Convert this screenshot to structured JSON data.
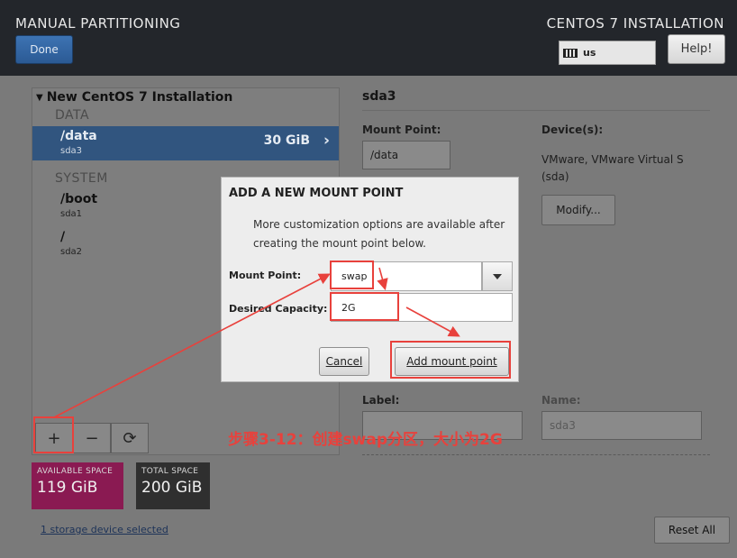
{
  "header": {
    "title": "MANUAL PARTITIONING",
    "install_title": "CENTOS 7 INSTALLATION",
    "done_label": "Done",
    "keyboard_layout": "us",
    "help_label": "Help!"
  },
  "partitions": {
    "root_label": "New CentOS 7 Installation",
    "groups": [
      {
        "label": "DATA",
        "items": [
          {
            "mount": "/data",
            "device": "sda3",
            "size": "30 GiB",
            "selected": true
          }
        ]
      },
      {
        "label": "SYSTEM",
        "items": [
          {
            "mount": "/boot",
            "device": "sda1"
          },
          {
            "mount": "/",
            "device": "sda2"
          }
        ]
      }
    ]
  },
  "toolbar": {
    "add_label": "+",
    "remove_label": "−",
    "refresh_label": "⟳"
  },
  "space": {
    "available_label": "AVAILABLE SPACE",
    "available_value": "119 GiB",
    "total_label": "TOTAL SPACE",
    "total_value": "200 GiB"
  },
  "storage_link": "1 storage device selected",
  "reset_label": "Reset All",
  "detail": {
    "title": "sda3",
    "mount_point_label": "Mount Point:",
    "mount_point_value": "/data",
    "devices_label": "Device(s):",
    "devices_line1": "VMware, VMware Virtual S",
    "devices_line2": "(sda)",
    "modify_label": "Modify...",
    "label_label": "Label:",
    "name_label": "Name:",
    "name_value": "sda3"
  },
  "dialog": {
    "title": "ADD A NEW MOUNT POINT",
    "description": "More customization options are available after creating the mount point below.",
    "mount_point_label": "Mount Point:",
    "mount_point_value": "swap",
    "capacity_label": "Desired Capacity:",
    "capacity_value": "2G",
    "cancel_label": "Cancel",
    "add_label": "Add mount point"
  },
  "annotation": {
    "text": "步骤3-12：创建swap分区，大小为2G",
    "color": "#e8413c"
  }
}
